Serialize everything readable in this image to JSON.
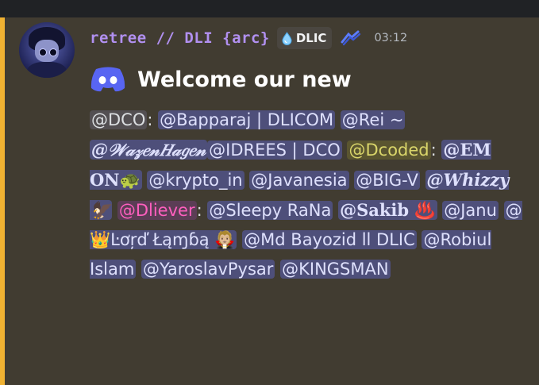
{
  "message": {
    "username": "retree // DLI {arc}",
    "tag": "DLIC",
    "timestamp": "03:12",
    "title": "Welcome our new",
    "mentions": {
      "dco": "@DCO",
      "bapparaj": "@Bapparaj  | DLICOM",
      "rei": "@Rei ~",
      "wazen": "@𝒲𝒶𝓏𝑒𝓃𝐻𝒶𝑔𝑒𝓃",
      "idrees": "@IDREES | DCO",
      "dcoded": "@Dcoded",
      "emon": "@𝐄𝐌 𝐎𝐍🐢",
      "krypto": "@krypto_in",
      "javanesia": "@Javanesia",
      "bigv": "@BIG-V",
      "whizzy": "@𝑾𝒉𝒊𝒛𝒛𝒚 🦅",
      "dliever": "@Dliever",
      "sleepy": "@Sleepy RaNa",
      "sakib": "@𝐒𝐚𝐤𝐢𝐛 ♨️",
      "janu": "@Janu",
      "lord": "@👑Ŀơŗď Łąɱɓą 🧛🏼",
      "bayozid": "@Md Bayozid ll DLIC",
      "robiul": "@Robiul Islam",
      "yaroslav": "@YaroslavPysar",
      "kingsman": "@KINGSMAN"
    },
    "separators": {
      "colon": ":"
    }
  },
  "icons": [
    "discord-clyde-icon",
    "water-drop-icon",
    "role-emblem-icon"
  ],
  "colors": {
    "accent": "#f0b232",
    "username": "#b190f0",
    "mention_bg": "#4e4f7a",
    "green_role": "#d9d56a",
    "pink_role": "#ff5fbe"
  }
}
